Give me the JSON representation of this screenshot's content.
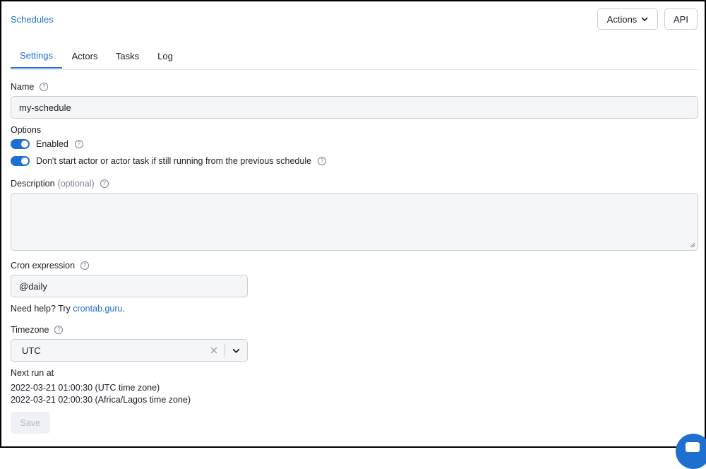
{
  "breadcrumb": "Schedules",
  "header": {
    "actions_label": "Actions",
    "api_label": "API"
  },
  "tabs": [
    {
      "label": "Settings",
      "active": true
    },
    {
      "label": "Actors"
    },
    {
      "label": "Tasks"
    },
    {
      "label": "Log"
    }
  ],
  "name": {
    "label": "Name",
    "value": "my-schedule"
  },
  "options": {
    "label": "Options",
    "enabled_label": "Enabled",
    "enabled": true,
    "no_overlap_label": "Don't start actor or actor task if still running from the previous schedule",
    "no_overlap": true
  },
  "description": {
    "label": "Description",
    "optional": "(optional)",
    "value": ""
  },
  "cron": {
    "label": "Cron expression",
    "value": "@daily",
    "help_prefix": "Need help? Try",
    "help_link": "crontab.guru",
    "help_suffix": "."
  },
  "timezone": {
    "label": "Timezone",
    "value": "UTC"
  },
  "next_run": {
    "label": "Next run at",
    "utc": "2022-03-21 01:00:30 (UTC time zone)",
    "local": "2022-03-21 02:00:30 (Africa/Lagos time zone)"
  },
  "save_label": "Save",
  "colors": {
    "accent": "#1f6fd1",
    "input_bg": "#f5f6f8",
    "border": "#c9ccd3"
  },
  "icons": [
    "chevron-down-icon",
    "help-icon",
    "clear-icon",
    "chat-icon"
  ]
}
